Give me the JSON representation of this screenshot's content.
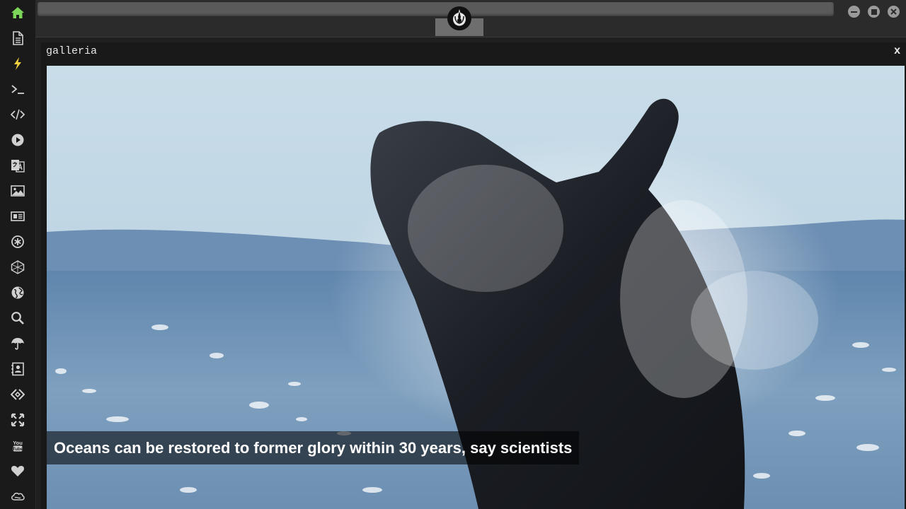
{
  "sidebar": {
    "items": [
      {
        "icon": "home-icon",
        "active": true
      },
      {
        "icon": "document-icon"
      },
      {
        "icon": "lightning-icon"
      },
      {
        "icon": "terminal-icon"
      },
      {
        "icon": "code-icon"
      },
      {
        "icon": "play-icon"
      },
      {
        "icon": "translate-icon"
      },
      {
        "icon": "image-icon"
      },
      {
        "icon": "news-icon"
      },
      {
        "icon": "settings-circle-icon"
      },
      {
        "icon": "cube-icon"
      },
      {
        "icon": "globe-icon"
      },
      {
        "icon": "search-icon"
      },
      {
        "icon": "umbrella-icon"
      },
      {
        "icon": "contact-icon"
      },
      {
        "icon": "code-diamond-icon"
      },
      {
        "icon": "expand-icon"
      },
      {
        "icon": "youtube-icon"
      },
      {
        "icon": "heart-icon"
      },
      {
        "icon": "cloud-icon"
      }
    ],
    "active_color": "#7cd65a",
    "icon_color": "#d0d0d0"
  },
  "window": {
    "controls": [
      "minimize-icon",
      "maximize-icon",
      "close-icon"
    ]
  },
  "panel": {
    "title": "galleria",
    "close_label": "x"
  },
  "gallery": {
    "caption": "Oceans can be restored to former glory within 30 years, say scientists"
  }
}
